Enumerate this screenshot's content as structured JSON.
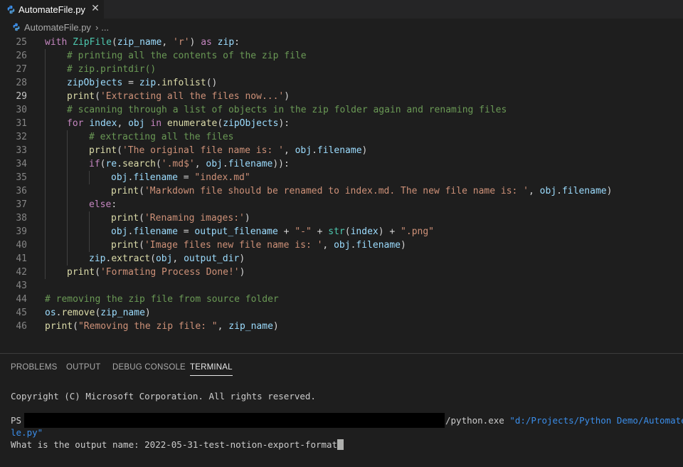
{
  "tab": {
    "filename": "AutomateFile.py",
    "close": "✕"
  },
  "breadcrumb": {
    "file": "AutomateFile.py",
    "separator": "›",
    "more": "..."
  },
  "editor": {
    "current_line": 29,
    "lines": [
      {
        "n": 25,
        "indent": 0,
        "tokens": [
          [
            "kw",
            "with "
          ],
          [
            "cl",
            "ZipFile"
          ],
          [
            "op",
            "("
          ],
          [
            "vr",
            "zip_name"
          ],
          [
            "op",
            ", "
          ],
          [
            "st",
            "'r'"
          ],
          [
            "op",
            ") "
          ],
          [
            "kw",
            "as "
          ],
          [
            "vr",
            "zip"
          ],
          [
            "op",
            ":"
          ]
        ]
      },
      {
        "n": 26,
        "indent": 1,
        "tokens": [
          [
            "cm",
            "# printing all the contents of the zip file"
          ]
        ]
      },
      {
        "n": 27,
        "indent": 1,
        "tokens": [
          [
            "cm",
            "# zip.printdir()"
          ]
        ]
      },
      {
        "n": 28,
        "indent": 1,
        "tokens": [
          [
            "vr",
            "zipObjects"
          ],
          [
            "op",
            " = "
          ],
          [
            "vr",
            "zip"
          ],
          [
            "op",
            "."
          ],
          [
            "fn",
            "infolist"
          ],
          [
            "op",
            "()"
          ]
        ]
      },
      {
        "n": 29,
        "indent": 1,
        "tokens": [
          [
            "fn",
            "print"
          ],
          [
            "op",
            "("
          ],
          [
            "st",
            "'Extracting all the files now...'"
          ],
          [
            "op",
            ")"
          ]
        ]
      },
      {
        "n": 30,
        "indent": 1,
        "tokens": [
          [
            "cm",
            "# scanning through a list of objects in the zip folder again and renaming files"
          ]
        ]
      },
      {
        "n": 31,
        "indent": 1,
        "tokens": [
          [
            "kw",
            "for "
          ],
          [
            "vr",
            "index"
          ],
          [
            "op",
            ", "
          ],
          [
            "vr",
            "obj"
          ],
          [
            "kw",
            " in "
          ],
          [
            "fn",
            "enumerate"
          ],
          [
            "op",
            "("
          ],
          [
            "vr",
            "zipObjects"
          ],
          [
            "op",
            "):"
          ]
        ]
      },
      {
        "n": 32,
        "indent": 2,
        "tokens": [
          [
            "cm",
            "# extracting all the files"
          ]
        ]
      },
      {
        "n": 33,
        "indent": 2,
        "tokens": [
          [
            "fn",
            "print"
          ],
          [
            "op",
            "("
          ],
          [
            "st",
            "'The original file name is: '"
          ],
          [
            "op",
            ", "
          ],
          [
            "vr",
            "obj"
          ],
          [
            "op",
            "."
          ],
          [
            "vr",
            "filename"
          ],
          [
            "op",
            ")"
          ]
        ]
      },
      {
        "n": 34,
        "indent": 2,
        "tokens": [
          [
            "kw",
            "if"
          ],
          [
            "op",
            "("
          ],
          [
            "vr",
            "re"
          ],
          [
            "op",
            "."
          ],
          [
            "fn",
            "search"
          ],
          [
            "op",
            "("
          ],
          [
            "st",
            "'.md$'"
          ],
          [
            "op",
            ", "
          ],
          [
            "vr",
            "obj"
          ],
          [
            "op",
            "."
          ],
          [
            "vr",
            "filename"
          ],
          [
            "op",
            "))"
          ],
          [
            "op",
            ":"
          ]
        ]
      },
      {
        "n": 35,
        "indent": 3,
        "tokens": [
          [
            "vr",
            "obj"
          ],
          [
            "op",
            "."
          ],
          [
            "vr",
            "filename"
          ],
          [
            "op",
            " = "
          ],
          [
            "st",
            "\"index.md\""
          ]
        ]
      },
      {
        "n": 36,
        "indent": 3,
        "tokens": [
          [
            "fn",
            "print"
          ],
          [
            "op",
            "("
          ],
          [
            "st",
            "'Markdown file should be renamed to index.md. The new file name is: '"
          ],
          [
            "op",
            ", "
          ],
          [
            "vr",
            "obj"
          ],
          [
            "op",
            "."
          ],
          [
            "vr",
            "filename"
          ],
          [
            "op",
            ")"
          ]
        ]
      },
      {
        "n": 37,
        "indent": 2,
        "tokens": [
          [
            "kw",
            "else"
          ],
          [
            "op",
            ":"
          ]
        ]
      },
      {
        "n": 38,
        "indent": 3,
        "tokens": [
          [
            "fn",
            "print"
          ],
          [
            "op",
            "("
          ],
          [
            "st",
            "'Renaming images:'"
          ],
          [
            "op",
            ")"
          ]
        ]
      },
      {
        "n": 39,
        "indent": 3,
        "tokens": [
          [
            "vr",
            "obj"
          ],
          [
            "op",
            "."
          ],
          [
            "vr",
            "filename"
          ],
          [
            "op",
            " = "
          ],
          [
            "vr",
            "output_filename"
          ],
          [
            "op",
            " + "
          ],
          [
            "st",
            "\"-\""
          ],
          [
            "op",
            " + "
          ],
          [
            "cl",
            "str"
          ],
          [
            "op",
            "("
          ],
          [
            "vr",
            "index"
          ],
          [
            "op",
            ")"
          ],
          [
            "op",
            " + "
          ],
          [
            "st",
            "\".png\""
          ]
        ]
      },
      {
        "n": 40,
        "indent": 3,
        "tokens": [
          [
            "fn",
            "print"
          ],
          [
            "op",
            "("
          ],
          [
            "st",
            "'Image files new file name is: '"
          ],
          [
            "op",
            ", "
          ],
          [
            "vr",
            "obj"
          ],
          [
            "op",
            "."
          ],
          [
            "vr",
            "filename"
          ],
          [
            "op",
            ")"
          ]
        ]
      },
      {
        "n": 41,
        "indent": 2,
        "tokens": [
          [
            "vr",
            "zip"
          ],
          [
            "op",
            "."
          ],
          [
            "fn",
            "extract"
          ],
          [
            "op",
            "("
          ],
          [
            "vr",
            "obj"
          ],
          [
            "op",
            ", "
          ],
          [
            "vr",
            "output_dir"
          ],
          [
            "op",
            ")"
          ]
        ]
      },
      {
        "n": 42,
        "indent": 1,
        "tokens": [
          [
            "fn",
            "print"
          ],
          [
            "op",
            "("
          ],
          [
            "st",
            "'Formating Process Done!'"
          ],
          [
            "op",
            ")"
          ]
        ]
      },
      {
        "n": 43,
        "indent": 0,
        "tokens": []
      },
      {
        "n": 44,
        "indent": 0,
        "tokens": [
          [
            "cm",
            "# removing the zip file from source folder"
          ]
        ]
      },
      {
        "n": 45,
        "indent": 0,
        "tokens": [
          [
            "vr",
            "os"
          ],
          [
            "op",
            "."
          ],
          [
            "fn",
            "remove"
          ],
          [
            "op",
            "("
          ],
          [
            "vr",
            "zip_name"
          ],
          [
            "op",
            ")"
          ]
        ]
      },
      {
        "n": 46,
        "indent": 0,
        "tokens": [
          [
            "fn",
            "print"
          ],
          [
            "op",
            "("
          ],
          [
            "st",
            "\"Removing the zip file: \""
          ],
          [
            "op",
            ", "
          ],
          [
            "vr",
            "zip_name"
          ],
          [
            "op",
            ")"
          ]
        ]
      }
    ]
  },
  "panel": {
    "tabs": [
      "PROBLEMS",
      "OUTPUT",
      "DEBUG CONSOLE",
      "TERMINAL"
    ],
    "active_tab": "TERMINAL"
  },
  "terminal": {
    "copyright": "Copyright (C) Microsoft Corporation. All rights reserved.",
    "prompt": "PS",
    "exe": "/python.exe",
    "script_path_1": "\"d:/Projects/Python Demo/AutomateFi",
    "script_path_2": "le.py\"",
    "question": "What is the output name: ",
    "answer": "2022-05-31-test-notion-export-format"
  },
  "colors": {
    "background": "#1e1e1e",
    "keyword": "#c586c0",
    "function": "#dcdcaa",
    "variable": "#9cdcfe",
    "string": "#ce9178",
    "comment": "#6a9955",
    "class": "#4ec9b0",
    "terminal_path": "#3b8eea"
  }
}
